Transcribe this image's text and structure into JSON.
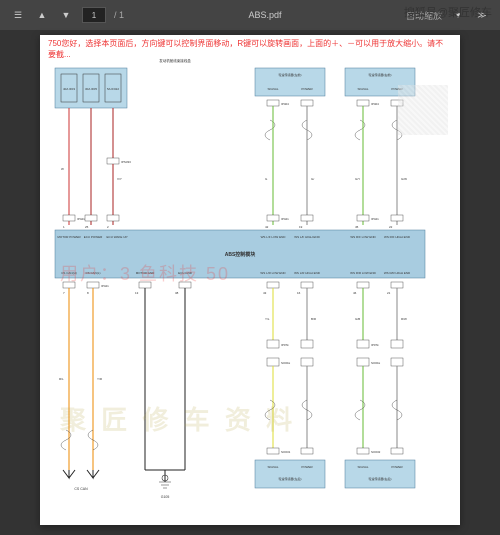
{
  "watermark": "搜狐号@聚匠修车",
  "toolbar": {
    "filename": "ABS.pdf",
    "page": "1",
    "total": "/ 1",
    "zoom": "自动缩放"
  },
  "hint": "750您好，选择本页面后，方向键可以控制界面移动，R键可以旋转画面，上面的＋、－可以用于放大缩小。请不要截...",
  "user_watermark": "用户：3            鱼科技       50",
  "logo_watermark": "聚 匠 修 车 资 料",
  "title_top": "发动机舱线束接线盒",
  "main_module": "ABS控制模块",
  "fuses": {
    "f1": "40A IF03",
    "f2": "30A IF05",
    "f3": "5A IF022"
  },
  "sensors": {
    "fl": {
      "title": "轮速传感器(左前)",
      "sig": "SIGNAL",
      "pwr": "POWER"
    },
    "fr": {
      "title": "轮速传感器(右前)"
    },
    "rl": {
      "title": "轮速传感器(左后)"
    },
    "rr": {
      "title": "轮速传感器(右后)"
    }
  },
  "pins_top": {
    "motor_pwr": "MOTOR POWER",
    "ecu_pwr": "ECU POWER",
    "ecu_wake": "ECU WAKE UP",
    "ws_lf_l": "WS L/F LOW END",
    "ws_lf_h": "WS L/F HIGH END",
    "ws_rf_l": "WS R/F LOW END",
    "ws_rf_h": "WS R/F HIGH END"
  },
  "pins_bot": {
    "cs_h": "CS CAN(H)",
    "cs_l": "CS CAN(L)",
    "motor_gnd": "MOTOR GND",
    "ecu_gnd": "ECU GND",
    "ws_lr_l": "WS L/R LOW END",
    "ws_lr_h": "WS L/R HIGH END",
    "ws_rr_l": "WS R/R LOW END",
    "ws_rr_h": "WS R/R HIGH END"
  },
  "conn": {
    "ip421": "IP421",
    "ip404": "IP404",
    "ips333": "IPS333",
    "ip07k": "IP07k",
    "so01k": "SO01k",
    "so031": "SO031",
    "so032": "SO032",
    "s001": "S001",
    "s002": "S002"
  },
  "bottom_labels": {
    "cscan": "CS CAN",
    "g105": "G105"
  },
  "wire_colors": {
    "w": "W",
    "vy": "V/Y",
    "g": "G",
    "gr": "Gr",
    "gy": "G/Y",
    "gw": "G/W",
    "rl": "R/L",
    "yr": "Y/R",
    "yl": "Y/L",
    "br": "B/R",
    "gb": "G/B",
    "rw": "R/W"
  },
  "pin_nums": {
    "p1": "1",
    "p2": "2",
    "p3": "3",
    "p7": "7",
    "p8": "8",
    "p13": "13",
    "p16": "16",
    "p19": "19",
    "p21": "21",
    "p22": "22",
    "p24": "24",
    "p25": "25",
    "p33": "33",
    "p38": "38",
    "p42": "42",
    "p43": "43",
    "p45": "45",
    "p46": "46"
  }
}
